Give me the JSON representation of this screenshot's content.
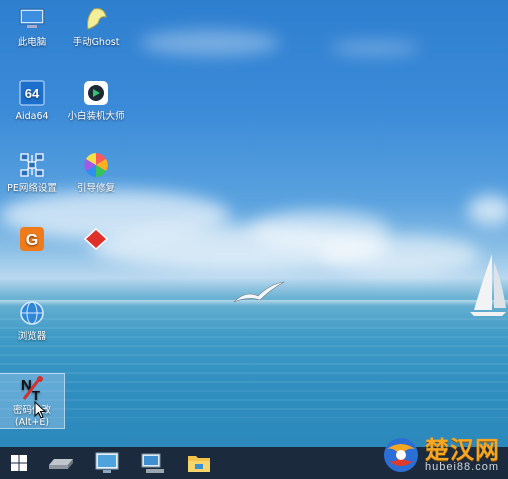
{
  "desktop_icons": [
    {
      "label": "此电脑",
      "icon": "computer-icon"
    },
    {
      "label": "手动Ghost",
      "icon": "ghost-icon"
    },
    {
      "label": "Aida64",
      "icon": "aida64-icon"
    },
    {
      "label": "小白装机大师",
      "icon": "installer-icon"
    },
    {
      "label": "PE网络设置",
      "icon": "network-settings-icon"
    },
    {
      "label": "引导修复",
      "icon": "boot-repair-icon"
    },
    {
      "label": "",
      "icon": "diskgenius-icon"
    },
    {
      "label": "",
      "icon": "red-diamond-icon"
    },
    {
      "label": "浏览器",
      "icon": "browser-icon"
    },
    {
      "label": "密码修改\n(Alt+E)",
      "icon": "password-tool-icon"
    }
  ],
  "taskbar": {
    "items": [
      "windows-start-icon",
      "drive-icon",
      "desktop-manager-icon",
      "network-icon",
      "file-explorer-icon"
    ]
  },
  "watermark": {
    "text": "楚汉网",
    "url": "hubei88.com"
  },
  "colors": {
    "taskbar": "#1b2a3c",
    "watermark": "#f5a623"
  }
}
